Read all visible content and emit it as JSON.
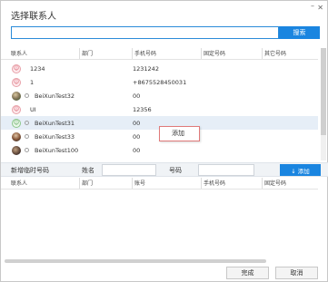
{
  "dialog": {
    "title": "选择联系人",
    "minimize_glyph": "–",
    "close_glyph": "✕"
  },
  "search": {
    "value": "",
    "placeholder": "",
    "button_label": "搜索"
  },
  "contacts_table": {
    "columns": [
      "联系人",
      "部门",
      "手机号码",
      "固定号码",
      "其它号码"
    ],
    "rows": [
      {
        "name": "1234",
        "avatar": "default-pink",
        "phone": "1231242"
      },
      {
        "name": "1",
        "avatar": "default-pink",
        "phone": "+8675528450031"
      },
      {
        "name": "BeiXunTest32",
        "avatar": "photo",
        "phone": "00"
      },
      {
        "name": "UI",
        "avatar": "default-pink",
        "phone": "12356"
      },
      {
        "name": "BeiXunTest31",
        "avatar": "default-green",
        "phone": "00"
      },
      {
        "name": "BeiXunTest33",
        "avatar": "photo",
        "phone": "00"
      },
      {
        "name": "BeiXunTest100",
        "avatar": "photo",
        "phone": "00"
      }
    ],
    "selected_index": 4
  },
  "context_menu": {
    "items": [
      "添加"
    ]
  },
  "add_temp": {
    "section_label": "新增临时号码",
    "name_label": "姓名",
    "name_value": "",
    "number_label": "号码",
    "number_value": "",
    "add_button_label": "↓ 添加"
  },
  "selected_table": {
    "columns": [
      "联系人",
      "部门",
      "账号",
      "手机号码",
      "固定号码"
    ]
  },
  "footer": {
    "ok_label": "完成",
    "cancel_label": "取消"
  },
  "colors": {
    "accent": "#1a85e0",
    "selected_row": "#e6eef7",
    "menu_border": "#e07a7a"
  }
}
